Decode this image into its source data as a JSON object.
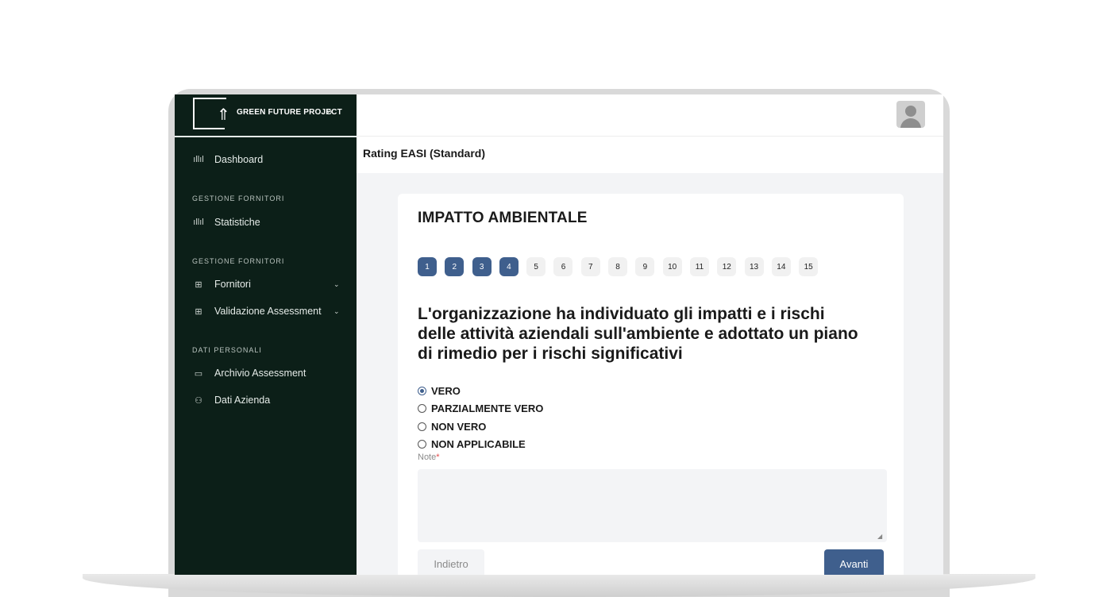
{
  "brand": {
    "name": "GREEN FUTURE PROJECT",
    "toggle_icon": "double-chevron-right-icon"
  },
  "sidebar": {
    "dashboard": {
      "label": "Dashboard",
      "icon": "bar-chart-icon"
    },
    "section1": "GESTIONE FORNITORI",
    "statistiche": {
      "label": "Statistiche",
      "icon": "bar-chart-icon"
    },
    "section2": "GESTIONE FORNITORI",
    "fornitori": {
      "label": "Fornitori",
      "icon": "supplier-icon"
    },
    "validazione": {
      "label": "Validazione Assessment",
      "icon": "supplier-icon"
    },
    "section3": "DATI PERSONALI",
    "archivio": {
      "label": "Archivio Assessment",
      "icon": "folder-icon"
    },
    "azienda": {
      "label": "Dati Azienda",
      "icon": "users-icon"
    }
  },
  "header": {
    "page_title": "Rating EASI (Standard)",
    "avatar_icon": "user-avatar-icon"
  },
  "card": {
    "title": "IMPATTO AMBIENTALE",
    "steps": [
      "1",
      "2",
      "3",
      "4",
      "5",
      "6",
      "7",
      "8",
      "9",
      "10",
      "11",
      "12",
      "13",
      "14",
      "15"
    ],
    "active_steps": [
      1,
      2,
      3,
      4
    ],
    "question": "L'organizzazione ha individuato gli impatti e i rischi delle attività aziendali sull'ambiente e adottato un piano di rimedio per i rischi significativi",
    "options": [
      "VERO",
      "PARZIALMENTE VERO",
      "NON VERO",
      "NON APPLICABILE"
    ],
    "selected_option": "VERO",
    "note_label": "Note",
    "note_required_mark": "*",
    "note_value": "",
    "back_label": "Indietro",
    "next_label": "Avanti"
  },
  "colors": {
    "sidebar_bg": "#0c1f18",
    "accent": "#3f5f8d"
  }
}
